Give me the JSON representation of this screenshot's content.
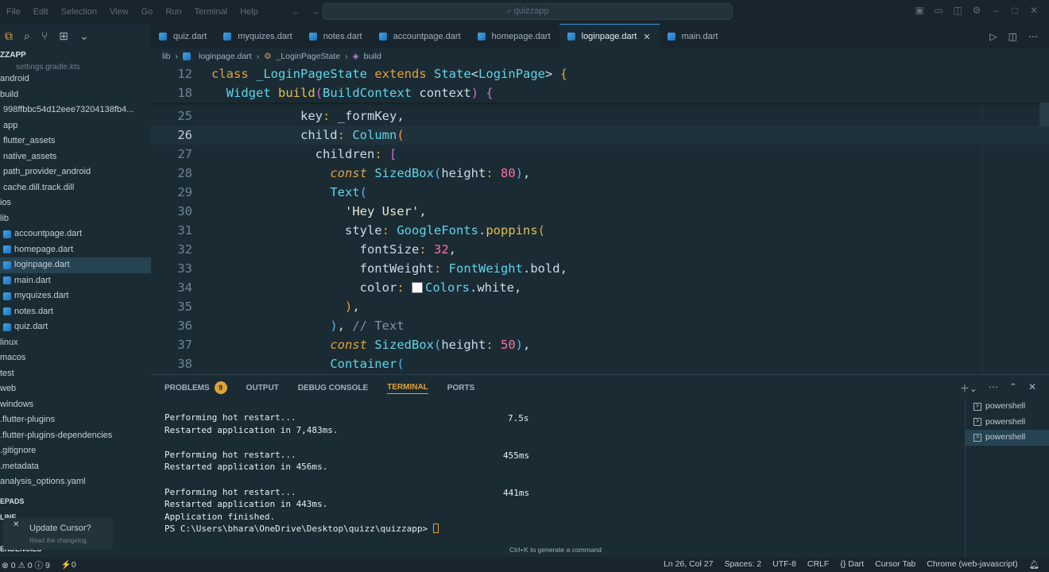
{
  "menu": [
    "File",
    "Edit",
    "Selection",
    "View",
    "Go",
    "Run",
    "Terminal",
    "Help"
  ],
  "command_center": "quizzapp",
  "sidebar": {
    "section_title": "ZZAPP",
    "cut_item": "settings.gradle.kts",
    "items": [
      {
        "label": "android",
        "kind": "folder",
        "indent": 0
      },
      {
        "label": "build",
        "kind": "folder",
        "indent": 0
      },
      {
        "label": "998ffbbc54d12eee73204138fb4...",
        "kind": "folder",
        "indent": 1
      },
      {
        "label": "app",
        "kind": "folder",
        "indent": 1
      },
      {
        "label": "flutter_assets",
        "kind": "folder",
        "indent": 1
      },
      {
        "label": "native_assets",
        "kind": "folder",
        "indent": 1
      },
      {
        "label": "path_provider_android",
        "kind": "folder",
        "indent": 1
      },
      {
        "label": "cache.dill.track.dill",
        "kind": "file",
        "indent": 1
      },
      {
        "label": "ios",
        "kind": "folder",
        "indent": 0
      },
      {
        "label": "lib",
        "kind": "folder",
        "indent": 0
      },
      {
        "label": "accountpage.dart",
        "kind": "dart",
        "indent": 1
      },
      {
        "label": "homepage.dart",
        "kind": "dart",
        "indent": 1
      },
      {
        "label": "loginpage.dart",
        "kind": "dart",
        "indent": 1,
        "selected": true
      },
      {
        "label": "main.dart",
        "kind": "dart",
        "indent": 1
      },
      {
        "label": "myquizes.dart",
        "kind": "dart",
        "indent": 1
      },
      {
        "label": "notes.dart",
        "kind": "dart",
        "indent": 1
      },
      {
        "label": "quiz.dart",
        "kind": "dart",
        "indent": 1
      },
      {
        "label": "linux",
        "kind": "folder",
        "indent": 0
      },
      {
        "label": "macos",
        "kind": "folder",
        "indent": 0
      },
      {
        "label": "test",
        "kind": "folder",
        "indent": 0
      },
      {
        "label": "web",
        "kind": "folder",
        "indent": 0
      },
      {
        "label": "windows",
        "kind": "folder",
        "indent": 0
      },
      {
        "label": ".flutter-plugins",
        "kind": "file",
        "indent": 0
      },
      {
        "label": ".flutter-plugins-dependencies",
        "kind": "file",
        "indent": 0
      },
      {
        "label": ".gitignore",
        "kind": "file",
        "indent": 0
      },
      {
        "label": ".metadata",
        "kind": "file",
        "indent": 0
      },
      {
        "label": "analysis_options.yaml",
        "kind": "file",
        "indent": 0
      }
    ],
    "bottom_sections": [
      "EPADS",
      "LINE",
      "ENDENCIES"
    ],
    "toast": {
      "title": "Update Cursor?",
      "subtitle": "Read the changelog."
    }
  },
  "tabs": [
    {
      "label": "quiz.dart",
      "active": false
    },
    {
      "label": "myquizes.dart",
      "active": false
    },
    {
      "label": "notes.dart",
      "active": false
    },
    {
      "label": "accountpage.dart",
      "active": false
    },
    {
      "label": "homepage.dart",
      "active": false
    },
    {
      "label": "loginpage.dart",
      "active": true
    },
    {
      "label": "main.dart",
      "active": false
    }
  ],
  "breadcrumb": [
    "lib",
    "loginpage.dart",
    "_LoginPageState",
    "build"
  ],
  "editor": {
    "line_numbers": [
      "12",
      "18",
      "25",
      "26",
      "27",
      "28",
      "29",
      "30",
      "31",
      "32",
      "33",
      "34",
      "35",
      "36",
      "37",
      "38"
    ],
    "current_line": "26"
  },
  "panel": {
    "tabs": [
      {
        "label": "PROBLEMS",
        "badge": "9"
      },
      {
        "label": "OUTPUT"
      },
      {
        "label": "DEBUG CONSOLE"
      },
      {
        "label": "TERMINAL",
        "active": true
      },
      {
        "label": "PORTS"
      }
    ],
    "terminal_lines": [
      "Performing hot restart...",
      "Restarted application in 7,483ms.",
      "",
      "Performing hot restart...",
      "Restarted application in 456ms.",
      "",
      "Performing hot restart...",
      "Restarted application in 443ms.",
      "Application finished.",
      "PS C:\\Users\\bhara\\OneDrive\\Desktop\\quizz\\quizzapp> "
    ],
    "timings": [
      "7.5s",
      "455ms",
      "441ms"
    ],
    "shells": [
      "powershell",
      "powershell",
      "powershell"
    ],
    "hint": "Ctrl+K to generate a command"
  },
  "status": {
    "left": [
      "⊗ 0 ⚠ 0 ⓘ 9",
      "⚡0"
    ],
    "right": [
      "Ln 26, Col 27",
      "Spaces: 2",
      "UTF-8",
      "CRLF",
      "{} Dart",
      "Cursor Tab",
      "Chrome (web-javascript)"
    ]
  },
  "colors": {
    "accent": "#e0a33a",
    "selection": "#264352",
    "background": "#1b2b34"
  }
}
